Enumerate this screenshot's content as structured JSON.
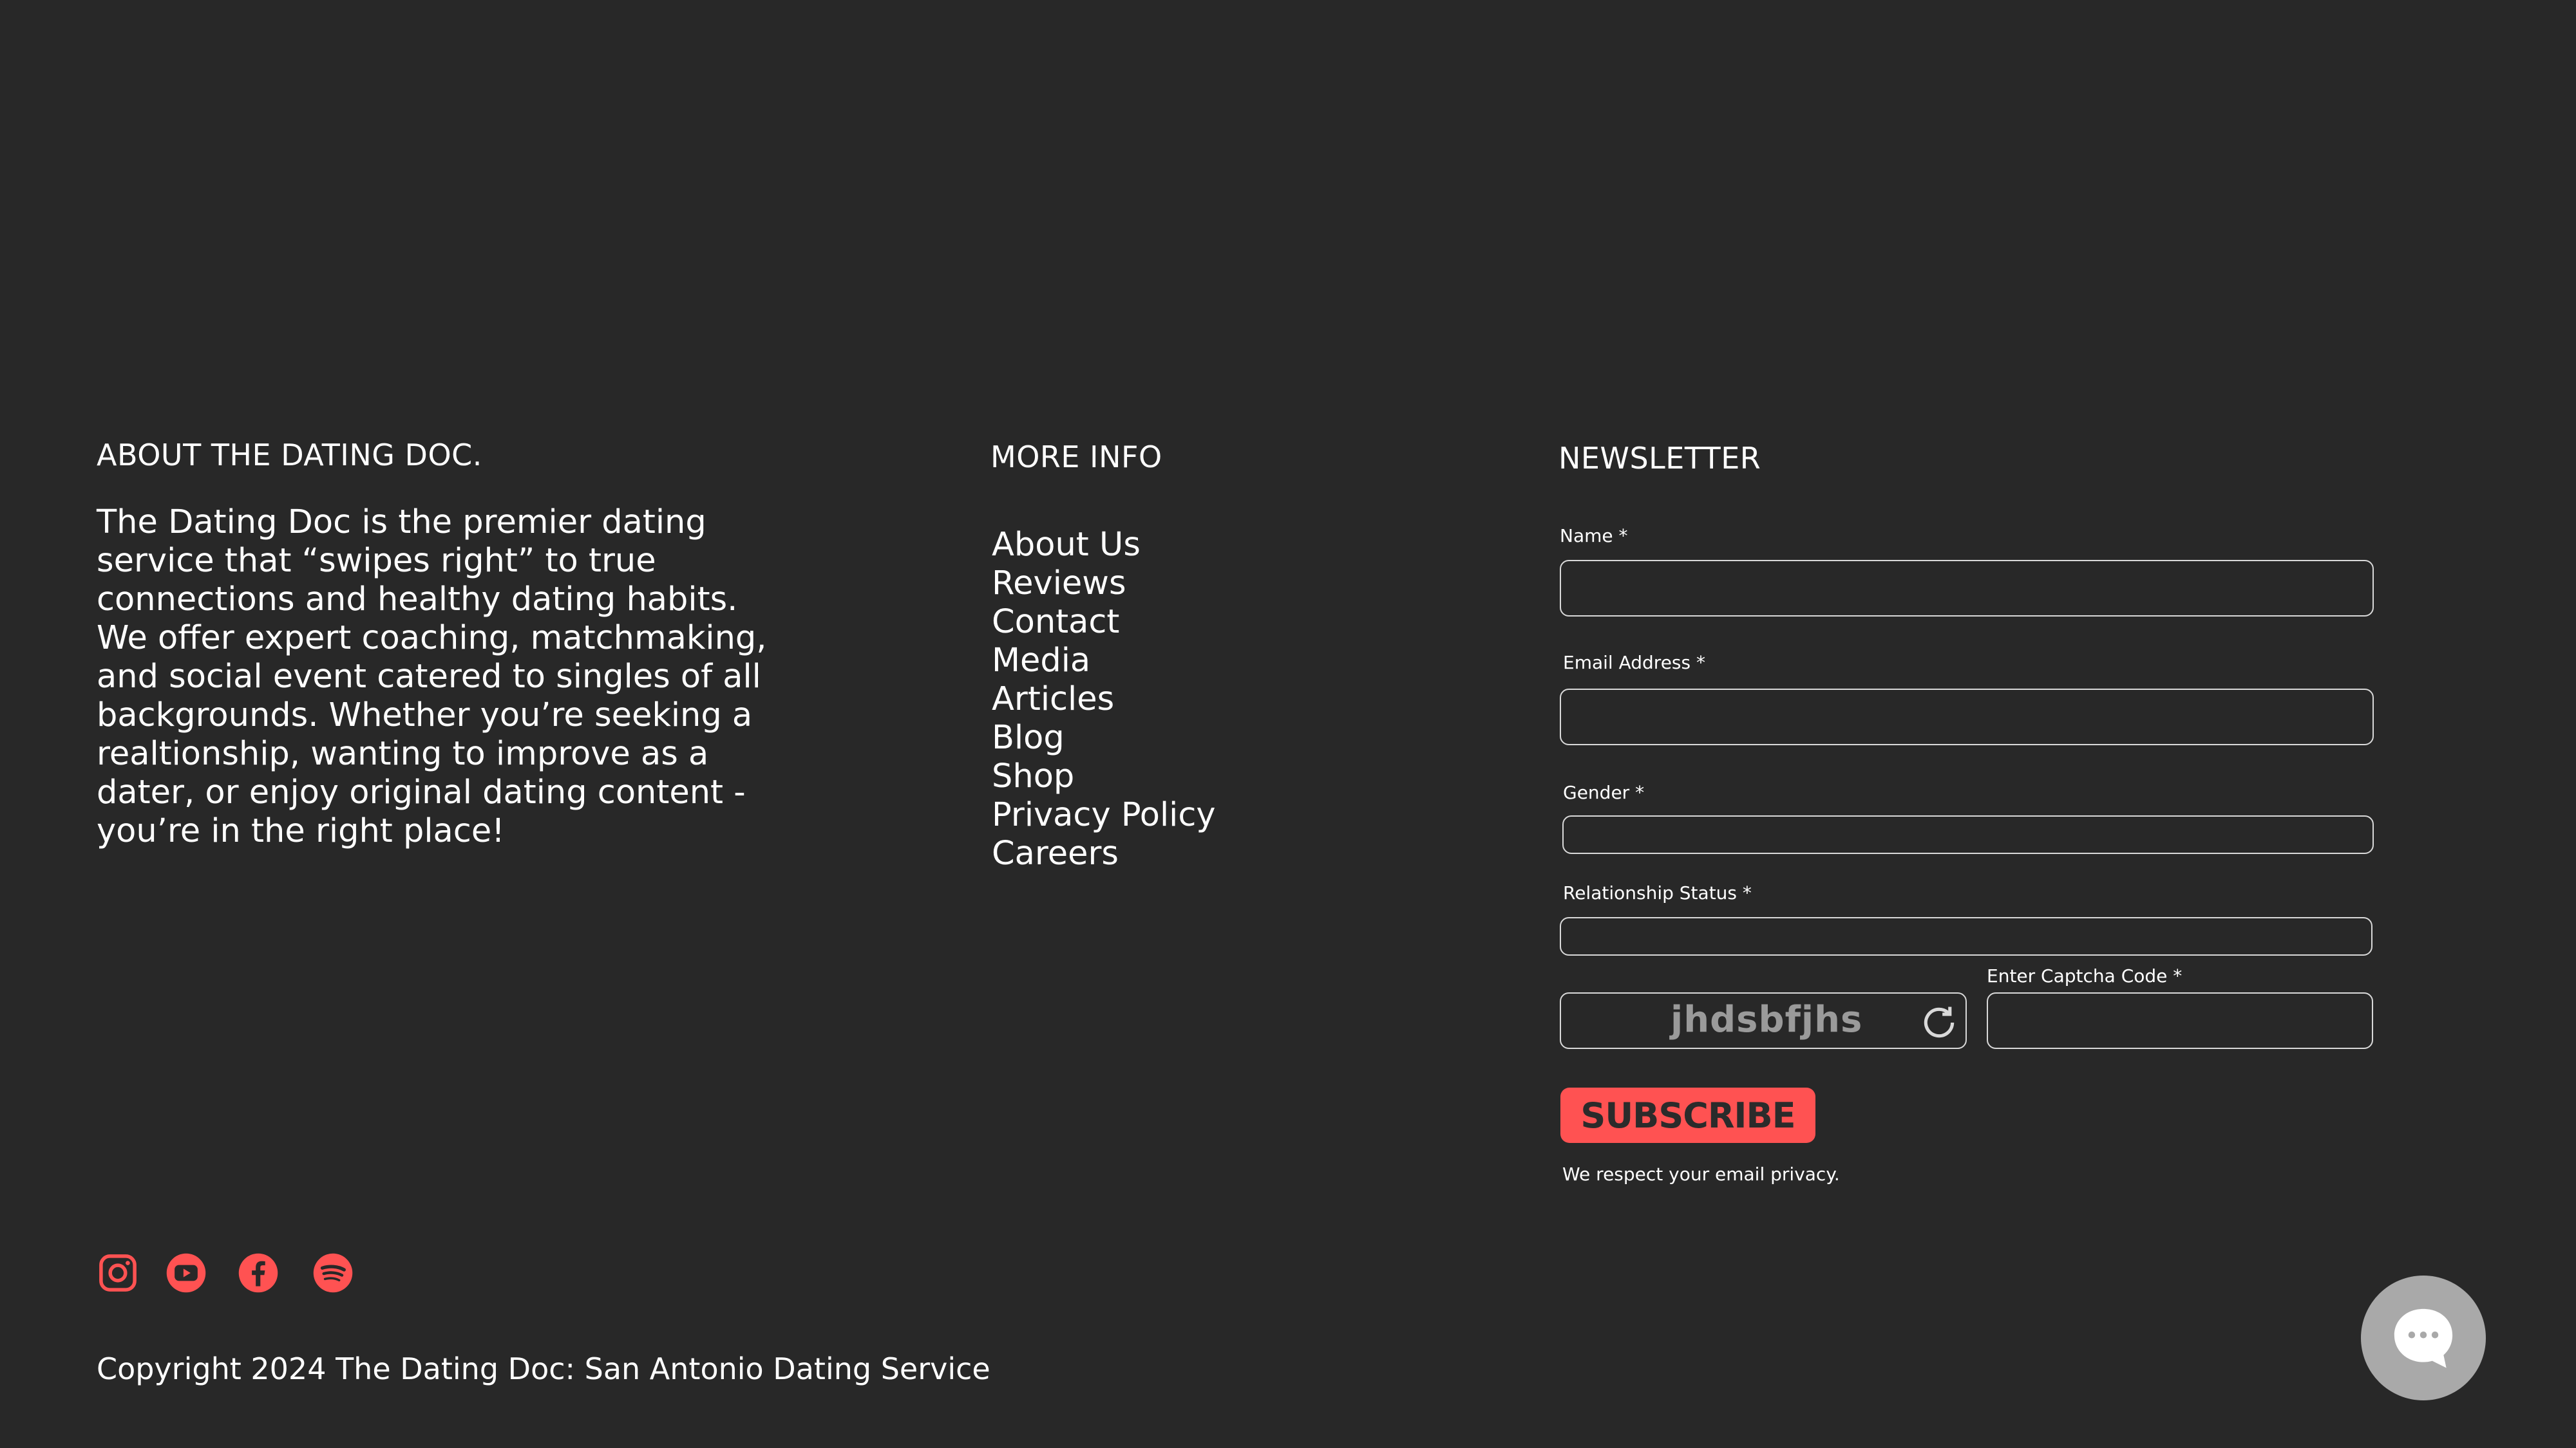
{
  "about": {
    "heading": "ABOUT THE DATING DOC.",
    "body": "The Dating Doc is the premier dating service that “swipes right” to true connections and healthy dating habits. We offer expert coaching, matchmaking, and social event catered to singles of all backgrounds. Whether you’re seeking a realtionship, wanting to improve as a dater, or enjoy original dating content - you’re in the right place!"
  },
  "more_info": {
    "heading": "MORE INFO",
    "links": [
      "About Us",
      "Reviews",
      "Contact",
      "Media",
      "Articles",
      "Blog",
      "Shop",
      "Privacy Policy",
      "Careers"
    ]
  },
  "newsletter": {
    "heading": "NEWSLETTER",
    "name_label": "Name *",
    "name_value": "",
    "email_label": "Email Address *",
    "email_value": "",
    "gender_label": "Gender *",
    "gender_value": "",
    "relationship_label": "Relationship Status *",
    "relationship_value": "",
    "captcha_label": "Enter Captcha Code *",
    "captcha_text": "jhdsbfjhs",
    "captcha_value": "",
    "subscribe_label": "SUBSCRIBE",
    "privacy_note": "We respect your email privacy."
  },
  "social": {
    "icons": [
      "instagram-icon",
      "youtube-icon",
      "facebook-icon",
      "spotify-icon"
    ]
  },
  "footer": {
    "copyright": "Copyright 2024 The Dating Doc: San Antonio Dating Service"
  },
  "colors": {
    "background": "#282828",
    "accent": "#ff5252",
    "chat_button": "#a9a9a9"
  }
}
